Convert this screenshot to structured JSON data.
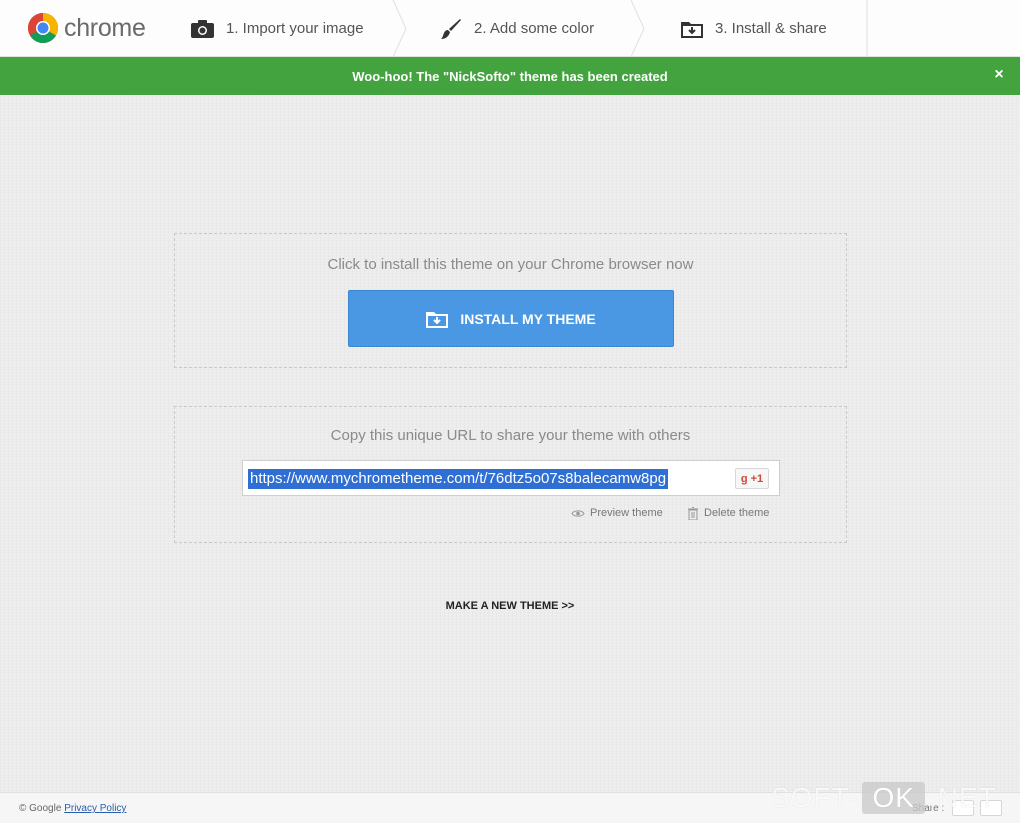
{
  "header": {
    "logo_text": "chrome",
    "steps": [
      {
        "label": "1. Import your image",
        "icon": "camera-icon"
      },
      {
        "label": "2. Add some color",
        "icon": "paintbrush-icon"
      },
      {
        "label": "3. Install & share",
        "icon": "install-icon"
      }
    ]
  },
  "banner": {
    "message": "Woo-hoo! The \"NickSofto\" theme has been created",
    "close_label": "×",
    "color": "#43a43f"
  },
  "install_box": {
    "caption": "Click to install this theme on your Chrome browser now",
    "button_label": "INSTALL MY THEME",
    "button_color": "#4a98e3"
  },
  "share_box": {
    "caption": "Copy this unique URL to share your theme with others",
    "url": "https://www.mychrometheme.com/t/76dtz5o07s8balecamw8pg",
    "gplus_label": "g +1",
    "preview_label": "Preview theme",
    "delete_label": "Delete theme"
  },
  "make_new_label": "MAKE A NEW THEME >>",
  "footer": {
    "copyright": "© Google",
    "privacy_label": "Privacy Policy",
    "share_label": "Share :"
  },
  "watermark": {
    "left": "SOFT-",
    "middle": "OK",
    "right": ".NET"
  }
}
